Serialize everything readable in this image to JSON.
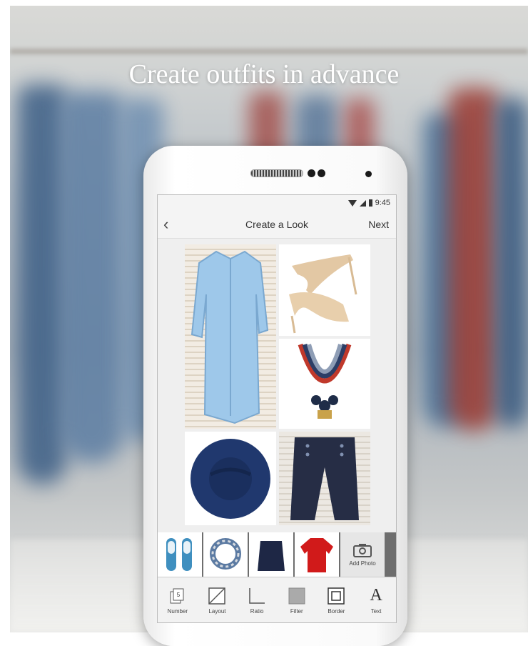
{
  "headline": "Create outfits in advance",
  "status_bar": {
    "time": "9:45"
  },
  "nav": {
    "title": "Create a Look",
    "next_label": "Next"
  },
  "collage": [
    {
      "item": "light blue shirt"
    },
    {
      "item": "nude heels"
    },
    {
      "item": "rope necklace"
    },
    {
      "item": "navy hat"
    },
    {
      "item": "navy pants"
    }
  ],
  "thumbnails": [
    {
      "item": "blue print shoes"
    },
    {
      "item": "scarf necklace"
    },
    {
      "item": "navy skirt"
    },
    {
      "item": "red top"
    }
  ],
  "add_photo_label": "Add Photo",
  "toolbar": [
    {
      "label": "Number",
      "badge": "5",
      "icon": "number-icon"
    },
    {
      "label": "Layout",
      "icon": "layout-icon"
    },
    {
      "label": "Ratio",
      "icon": "ratio-icon"
    },
    {
      "label": "Filter",
      "icon": "filter-icon"
    },
    {
      "label": "Border",
      "icon": "border-icon"
    },
    {
      "label": "Text",
      "glyph": "A",
      "icon": "text-icon"
    }
  ],
  "colors": {
    "headline": "#ffffff",
    "screen_bg": "#efefef",
    "thumb_strip": "#6e6e6e"
  }
}
